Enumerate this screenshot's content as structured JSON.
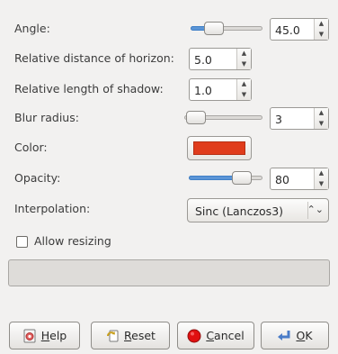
{
  "angle": {
    "label": "Angle:",
    "value": "45.0",
    "slider_level": 0.26
  },
  "horizon": {
    "label": "Relative distance of horizon:",
    "value": "5.0"
  },
  "shadow_length": {
    "label": "Relative length of shadow:",
    "value": "1.0"
  },
  "blur": {
    "label": "Blur radius:",
    "value": "3",
    "slider_level": 0.03
  },
  "color": {
    "label": "Color:",
    "swatch": "#e03c1c"
  },
  "opacity": {
    "label": "Opacity:",
    "value": "80",
    "slider_level": 0.8
  },
  "interpolation": {
    "label": "Interpolation:",
    "selected": "Sinc (Lanczos3)"
  },
  "allow_resizing": {
    "label": "Allow resizing",
    "checked": false
  },
  "buttons": {
    "help": {
      "mnemonic": "H",
      "rest": "elp"
    },
    "reset": {
      "mnemonic": "R",
      "rest": "eset"
    },
    "cancel": {
      "mnemonic": "C",
      "rest": "ancel"
    },
    "ok": {
      "mnemonic": "O",
      "rest": "K"
    }
  },
  "icons": [
    "help-icon",
    "reset-icon",
    "cancel-icon",
    "ok-icon",
    "spin-up-icon",
    "spin-down-icon",
    "combo-arrow-icon"
  ]
}
